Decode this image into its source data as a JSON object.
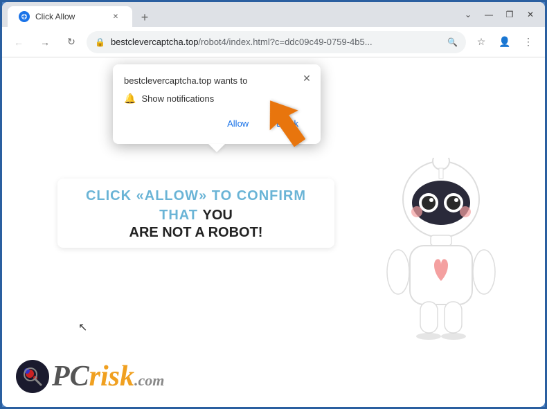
{
  "browser": {
    "title": "Click Allow",
    "tab_title": "Click Allow",
    "url_domain": "bestclevercaptcha.top",
    "url_path": "/robot4/index.html?c=ddc09c49-0759-4b5...",
    "new_tab_label": "+",
    "window_controls": {
      "minimize": "—",
      "maximize": "❒",
      "close": "✕"
    }
  },
  "notification_popup": {
    "title": "bestclevercaptcha.top wants to",
    "notification_text": "Show notifications",
    "allow_label": "Allow",
    "block_label": "Block",
    "close_label": "✕"
  },
  "page": {
    "captcha_line1": "CLICK «ALLOW» TO CONFIRM THAT YOU",
    "captcha_line2": "ARE NOT A ROBOT!",
    "captcha_line1_colored": "CLICK «ALLOW» TO CONFIRM THAT ",
    "captcha_line1_black": "YOU"
  },
  "logo": {
    "pc": "PC",
    "risk": "risk",
    "com": ".com"
  },
  "icons": {
    "back": "←",
    "forward": "→",
    "refresh": "↻",
    "lock": "🔒",
    "search": "🔍",
    "star": "☆",
    "profile": "👤",
    "menu": "⋮",
    "bell": "🔔"
  }
}
